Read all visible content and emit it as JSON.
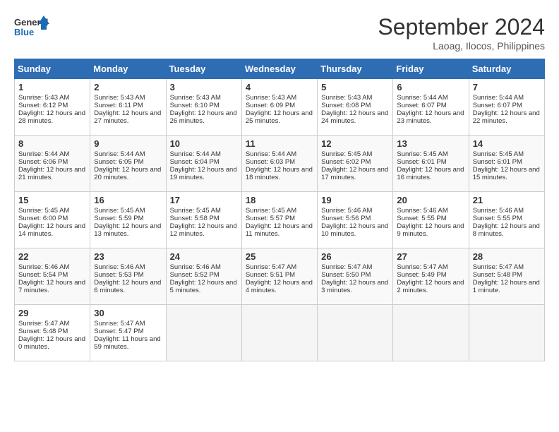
{
  "logo": {
    "line1": "General",
    "line2": "Blue"
  },
  "title": "September 2024",
  "location": "Laoag, Ilocos, Philippines",
  "weekdays": [
    "Sunday",
    "Monday",
    "Tuesday",
    "Wednesday",
    "Thursday",
    "Friday",
    "Saturday"
  ],
  "weeks": [
    [
      {
        "day": 1,
        "rise": "5:43 AM",
        "set": "6:12 PM",
        "daylight": "12 hours and 28 minutes."
      },
      {
        "day": 2,
        "rise": "5:43 AM",
        "set": "6:11 PM",
        "daylight": "12 hours and 27 minutes."
      },
      {
        "day": 3,
        "rise": "5:43 AM",
        "set": "6:10 PM",
        "daylight": "12 hours and 26 minutes."
      },
      {
        "day": 4,
        "rise": "5:43 AM",
        "set": "6:09 PM",
        "daylight": "12 hours and 25 minutes."
      },
      {
        "day": 5,
        "rise": "5:43 AM",
        "set": "6:08 PM",
        "daylight": "12 hours and 24 minutes."
      },
      {
        "day": 6,
        "rise": "5:44 AM",
        "set": "6:07 PM",
        "daylight": "12 hours and 23 minutes."
      },
      {
        "day": 7,
        "rise": "5:44 AM",
        "set": "6:07 PM",
        "daylight": "12 hours and 22 minutes."
      }
    ],
    [
      {
        "day": 8,
        "rise": "5:44 AM",
        "set": "6:06 PM",
        "daylight": "12 hours and 21 minutes."
      },
      {
        "day": 9,
        "rise": "5:44 AM",
        "set": "6:05 PM",
        "daylight": "12 hours and 20 minutes."
      },
      {
        "day": 10,
        "rise": "5:44 AM",
        "set": "6:04 PM",
        "daylight": "12 hours and 19 minutes."
      },
      {
        "day": 11,
        "rise": "5:44 AM",
        "set": "6:03 PM",
        "daylight": "12 hours and 18 minutes."
      },
      {
        "day": 12,
        "rise": "5:45 AM",
        "set": "6:02 PM",
        "daylight": "12 hours and 17 minutes."
      },
      {
        "day": 13,
        "rise": "5:45 AM",
        "set": "6:01 PM",
        "daylight": "12 hours and 16 minutes."
      },
      {
        "day": 14,
        "rise": "5:45 AM",
        "set": "6:01 PM",
        "daylight": "12 hours and 15 minutes."
      }
    ],
    [
      {
        "day": 15,
        "rise": "5:45 AM",
        "set": "6:00 PM",
        "daylight": "12 hours and 14 minutes."
      },
      {
        "day": 16,
        "rise": "5:45 AM",
        "set": "5:59 PM",
        "daylight": "12 hours and 13 minutes."
      },
      {
        "day": 17,
        "rise": "5:45 AM",
        "set": "5:58 PM",
        "daylight": "12 hours and 12 minutes."
      },
      {
        "day": 18,
        "rise": "5:45 AM",
        "set": "5:57 PM",
        "daylight": "12 hours and 11 minutes."
      },
      {
        "day": 19,
        "rise": "5:46 AM",
        "set": "5:56 PM",
        "daylight": "12 hours and 10 minutes."
      },
      {
        "day": 20,
        "rise": "5:46 AM",
        "set": "5:55 PM",
        "daylight": "12 hours and 9 minutes."
      },
      {
        "day": 21,
        "rise": "5:46 AM",
        "set": "5:55 PM",
        "daylight": "12 hours and 8 minutes."
      }
    ],
    [
      {
        "day": 22,
        "rise": "5:46 AM",
        "set": "5:54 PM",
        "daylight": "12 hours and 7 minutes."
      },
      {
        "day": 23,
        "rise": "5:46 AM",
        "set": "5:53 PM",
        "daylight": "12 hours and 6 minutes."
      },
      {
        "day": 24,
        "rise": "5:46 AM",
        "set": "5:52 PM",
        "daylight": "12 hours and 5 minutes."
      },
      {
        "day": 25,
        "rise": "5:47 AM",
        "set": "5:51 PM",
        "daylight": "12 hours and 4 minutes."
      },
      {
        "day": 26,
        "rise": "5:47 AM",
        "set": "5:50 PM",
        "daylight": "12 hours and 3 minutes."
      },
      {
        "day": 27,
        "rise": "5:47 AM",
        "set": "5:49 PM",
        "daylight": "12 hours and 2 minutes."
      },
      {
        "day": 28,
        "rise": "5:47 AM",
        "set": "5:48 PM",
        "daylight": "12 hours and 1 minute."
      }
    ],
    [
      {
        "day": 29,
        "rise": "5:47 AM",
        "set": "5:48 PM",
        "daylight": "12 hours and 0 minutes."
      },
      {
        "day": 30,
        "rise": "5:47 AM",
        "set": "5:47 PM",
        "daylight": "11 hours and 59 minutes."
      },
      null,
      null,
      null,
      null,
      null
    ]
  ]
}
